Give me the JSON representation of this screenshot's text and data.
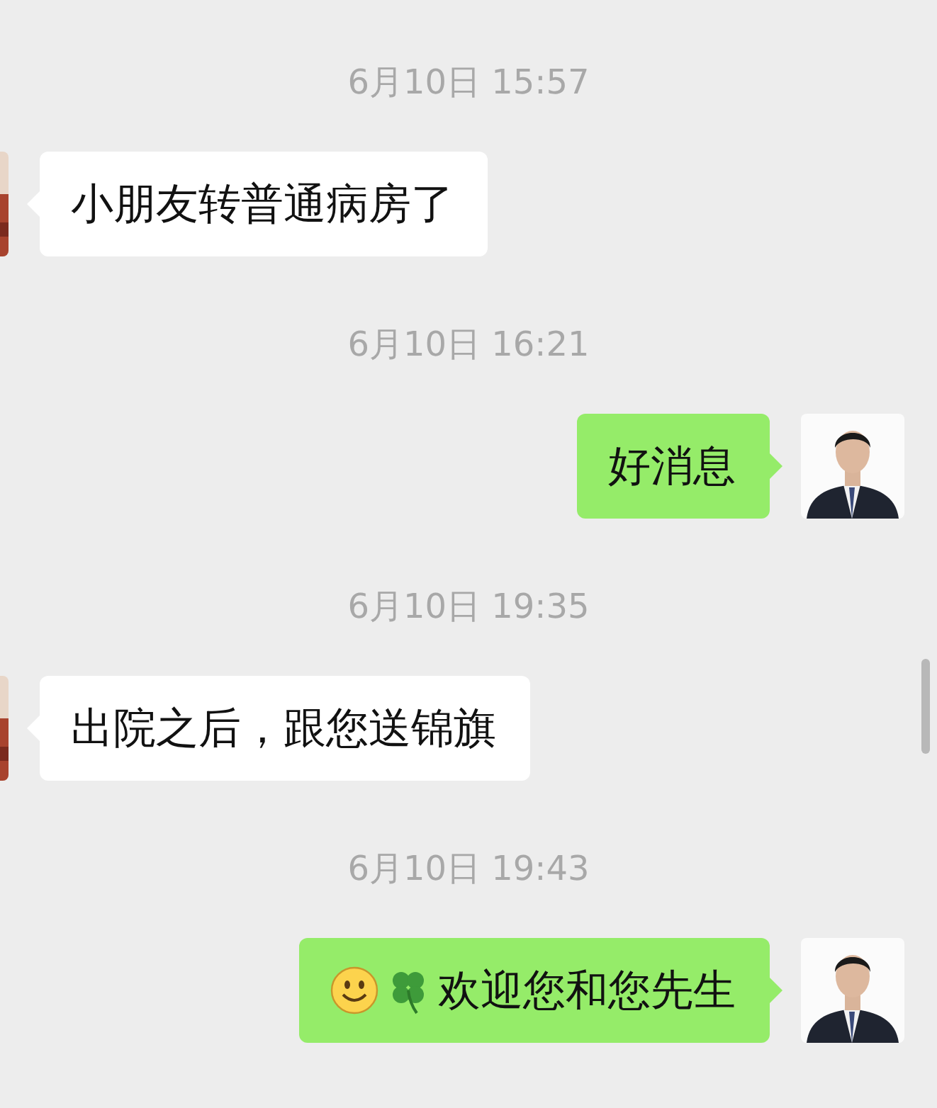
{
  "messages": [
    {
      "time": "6月10日 15:57",
      "kind": "incoming",
      "text": "小朋友转普通病房了"
    },
    {
      "time": "6月10日 16:21",
      "kind": "outgoing",
      "text": "好消息"
    },
    {
      "time": "6月10日 19:35",
      "kind": "incoming",
      "text": "出院之后，跟您送锦旗"
    },
    {
      "time": "6月10日 19:43",
      "kind": "outgoing",
      "icons": [
        {
          "kind": "smiley"
        },
        {
          "kind": "clover"
        }
      ],
      "text": "欢迎您和您先生"
    }
  ]
}
